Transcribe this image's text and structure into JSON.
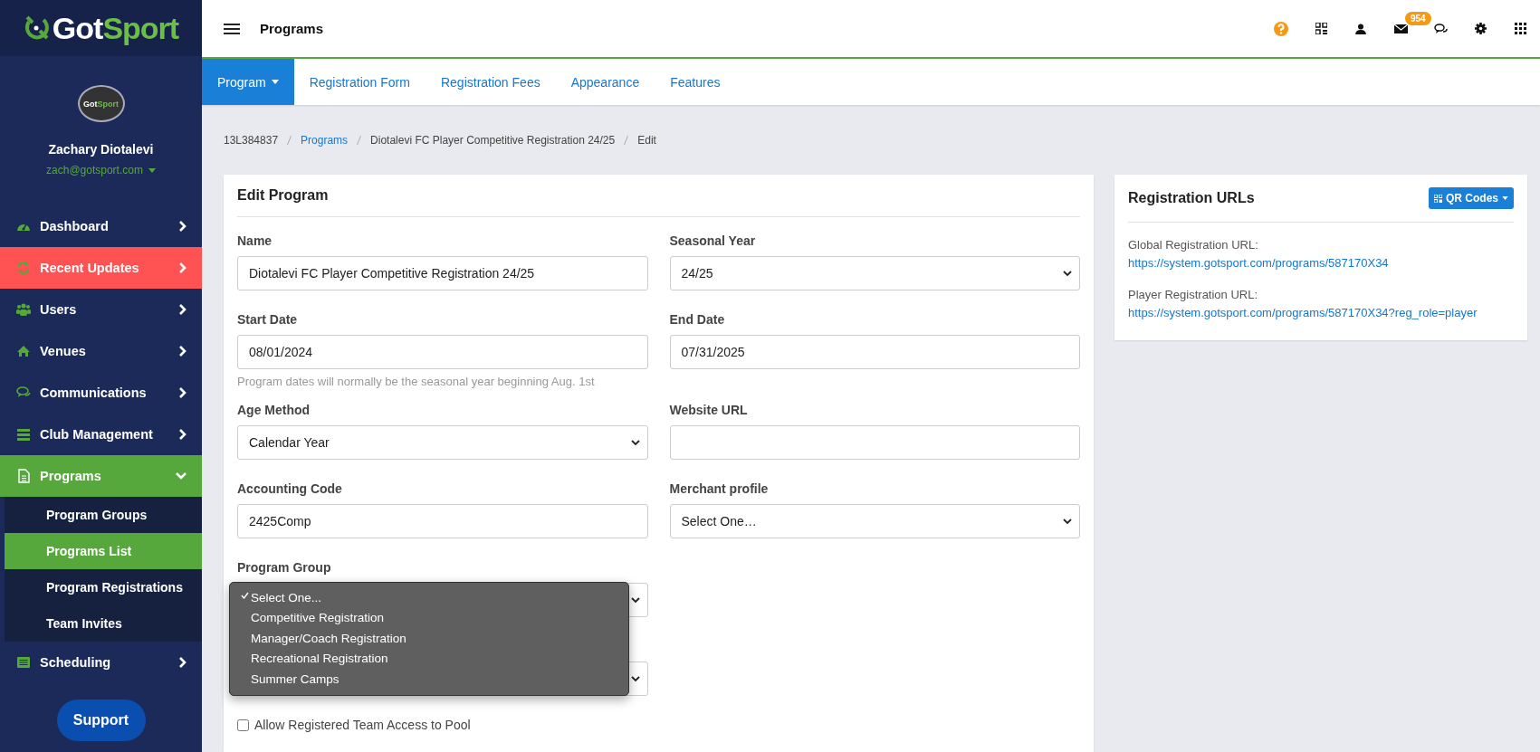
{
  "logo": {
    "part_1": "Got",
    "part_2": "Sport"
  },
  "avatar": {
    "part_1": "Got",
    "part_2": "Sport"
  },
  "user": {
    "name": "Zachary Diotalevi",
    "email": "zach@gotsport.com"
  },
  "nav": [
    {
      "label": "Dashboard",
      "selected": false,
      "highlighted": false,
      "expanded": false
    },
    {
      "label": "Recent Updates",
      "selected": false,
      "highlighted": true,
      "expanded": false
    },
    {
      "label": "Users",
      "selected": false,
      "highlighted": false,
      "expanded": false
    },
    {
      "label": "Venues",
      "selected": false,
      "highlighted": false,
      "expanded": false
    },
    {
      "label": "Communications",
      "selected": false,
      "highlighted": false,
      "expanded": false
    },
    {
      "label": "Club Management",
      "selected": false,
      "highlighted": false,
      "expanded": false
    },
    {
      "label": "Programs",
      "selected": true,
      "highlighted": false,
      "expanded": true,
      "children": [
        {
          "label": "Program Groups",
          "selected": false
        },
        {
          "label": "Programs List",
          "selected": true
        },
        {
          "label": "Program Registrations",
          "selected": false
        },
        {
          "label": "Team Invites",
          "selected": false
        }
      ]
    },
    {
      "label": "Scheduling",
      "selected": false,
      "highlighted": false,
      "expanded": false
    }
  ],
  "support_button": "Support",
  "topbar": {
    "title": "Programs",
    "icons": [
      {
        "kind": "help"
      },
      {
        "kind": "qr"
      },
      {
        "kind": "user"
      },
      {
        "kind": "mail",
        "badge": "954"
      },
      {
        "kind": "chat"
      },
      {
        "kind": "settings"
      },
      {
        "kind": "apps"
      }
    ]
  },
  "tabs": [
    {
      "label": "Program",
      "selected": true,
      "caret": true
    },
    {
      "label": "Registration Form",
      "selected": false,
      "caret": false
    },
    {
      "label": "Registration Fees",
      "selected": false,
      "caret": false
    },
    {
      "label": "Appearance",
      "selected": false,
      "caret": false
    },
    {
      "label": "Features",
      "selected": false,
      "caret": false
    }
  ],
  "breadcrumb": [
    {
      "label": "13L384837",
      "link": false
    },
    {
      "label": "Programs",
      "link": true
    },
    {
      "label": "Diotalevi FC Player Competitive Registration 24/25",
      "link": false
    },
    {
      "label": "Edit",
      "link": false
    }
  ],
  "edit_card": {
    "title": "Edit Program",
    "fields": [
      {
        "kind": "text",
        "label": "Name",
        "value": "Diotalevi FC Player Competitive Registration 24/25"
      },
      {
        "kind": "select",
        "label": "Seasonal Year",
        "value": "24/25"
      },
      {
        "kind": "text",
        "label": "Start Date",
        "value": "08/01/2024",
        "help": "Program dates will normally be the seasonal year beginning Aug. 1st"
      },
      {
        "kind": "text",
        "label": "End Date",
        "value": "07/31/2025"
      },
      {
        "kind": "select",
        "label": "Age Method",
        "value": "Calendar Year"
      },
      {
        "kind": "text",
        "label": "Website URL"
      },
      {
        "kind": "text",
        "label": "Accounting Code",
        "value": "2425Comp"
      },
      {
        "kind": "select",
        "label": "Merchant profile",
        "value": "Select One…"
      },
      {
        "kind": "select",
        "label": "Program Group",
        "open": true,
        "options": [
          {
            "label": "Select One...",
            "selected": true
          },
          {
            "label": "Competitive Registration",
            "selected": false
          },
          {
            "label": "Manager/Coach Registration",
            "selected": false
          },
          {
            "label": "Recreational Registration",
            "selected": false
          },
          {
            "label": "Summer Camps",
            "selected": false
          }
        ]
      },
      {
        "kind": "spacer"
      },
      {
        "kind": "select"
      }
    ],
    "checkbox": {
      "label": "Allow Registered Team Access to Pool",
      "checked": false
    }
  },
  "urls_card": {
    "title": "Registration URLs",
    "button": "QR Codes",
    "urls": [
      {
        "label": "Global Registration URL:",
        "url": "https://system.gotsport.com/programs/587170X34"
      },
      {
        "label": "Player Registration URL:",
        "url": "https://system.gotsport.com/programs/587170X34?reg_role=player"
      }
    ]
  }
}
